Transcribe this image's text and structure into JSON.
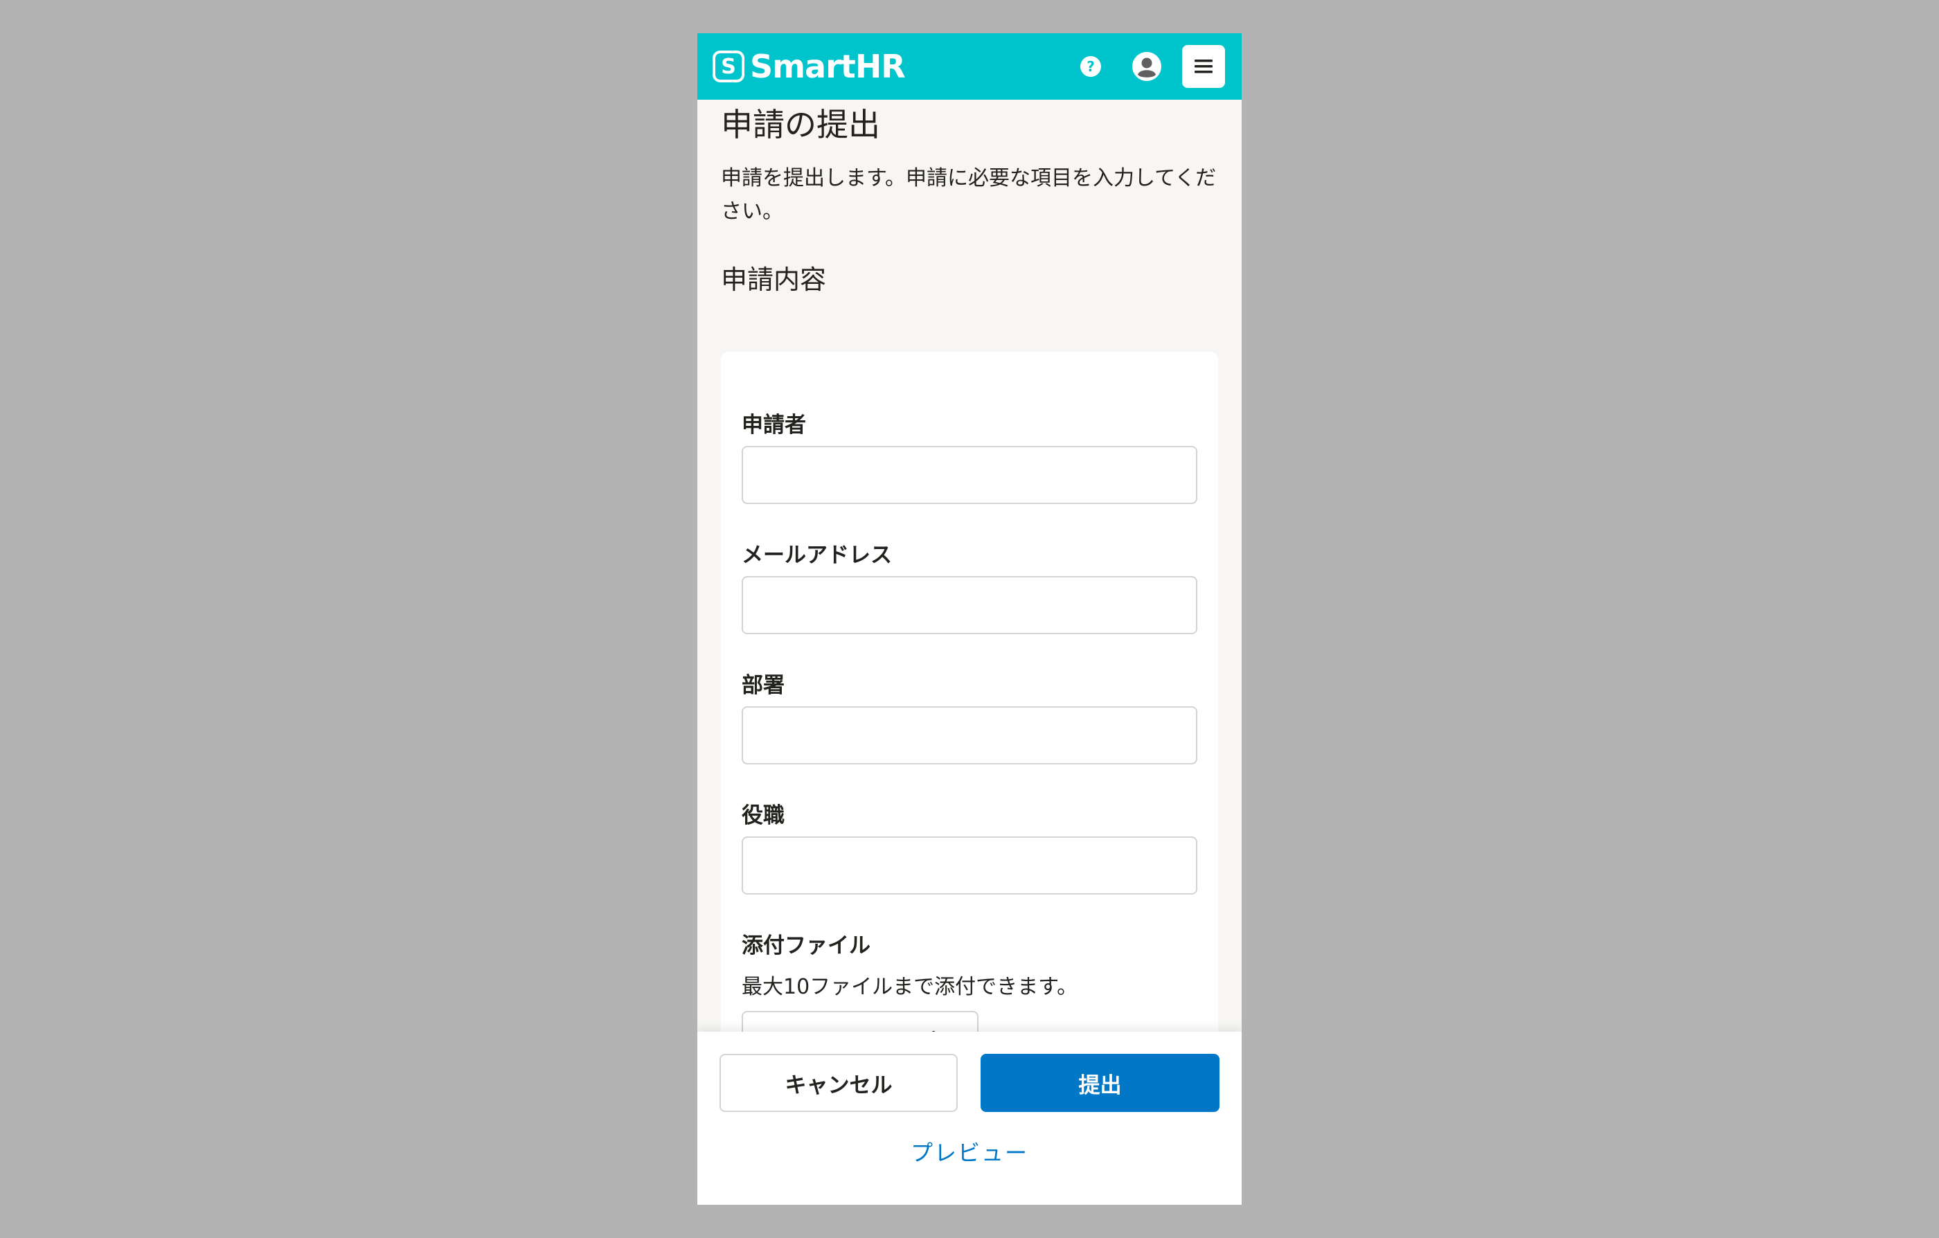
{
  "header": {
    "logo_mark": "S",
    "logo_text": "SmartHR",
    "help_glyph": "?",
    "background_color": "#00c4cc"
  },
  "page": {
    "title": "申請の提出",
    "description": "申請を提出します。申請に必要な項目を入力してください。",
    "section_title": "申請内容"
  },
  "form": {
    "fields": [
      {
        "label": "申請者",
        "value": ""
      },
      {
        "label": "メールアドレス",
        "value": ""
      },
      {
        "label": "部署",
        "value": ""
      },
      {
        "label": "役職",
        "value": ""
      }
    ],
    "attachment": {
      "label": "添付ファイル",
      "hint": "最大10ファイルまで添付できます。",
      "button_label": "ファイルを選択"
    }
  },
  "footer": {
    "cancel_label": "キャンセル",
    "submit_label": "提出",
    "preview_label": "プレビュー",
    "primary_color": "#0077c7"
  },
  "icons": {
    "help": "question-circle-icon",
    "user": "user-circle-icon",
    "menu": "hamburger-icon",
    "folder": "folder-open-icon"
  }
}
